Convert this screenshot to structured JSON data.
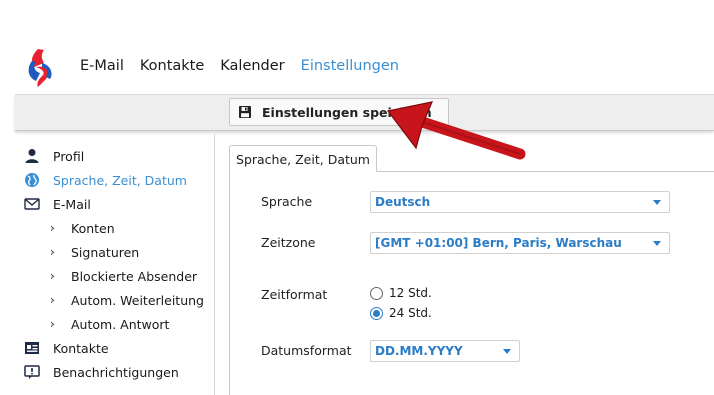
{
  "nav": {
    "items": [
      {
        "label": "E-Mail"
      },
      {
        "label": "Kontakte"
      },
      {
        "label": "Kalender"
      },
      {
        "label": "Einstellungen"
      }
    ],
    "active_index": 3
  },
  "toolbar": {
    "save_label": "Einstellungen speichern",
    "save_icon": "floppy-disk-icon"
  },
  "sidebar": {
    "items": [
      {
        "label": "Profil",
        "icon": "user-icon"
      },
      {
        "label": "Sprache, Zeit, Datum",
        "icon": "globe-icon"
      },
      {
        "label": "E-Mail",
        "icon": "envelope-icon"
      },
      {
        "label": "Konten"
      },
      {
        "label": "Signaturen"
      },
      {
        "label": "Blockierte Absender"
      },
      {
        "label": "Autom. Weiterleitung"
      },
      {
        "label": "Autom. Antwort"
      },
      {
        "label": "Kontakte",
        "icon": "contacts-icon"
      },
      {
        "label": "Benachrichtigungen",
        "icon": "notification-icon"
      }
    ]
  },
  "main": {
    "tab_label": "Sprache, Zeit, Datum",
    "sprache": {
      "label": "Sprache",
      "value": "Deutsch"
    },
    "zeitzone": {
      "label": "Zeitzone",
      "value": "[GMT +01:00] Bern, Paris, Warschau"
    },
    "zeitformat": {
      "label": "Zeitformat",
      "options": [
        "12 Std.",
        "24 Std."
      ],
      "selected": "24 Std."
    },
    "datumsformat": {
      "label": "Datumsformat",
      "value": "DD.MM.YYYY"
    }
  },
  "colors": {
    "accent": "#3a8fd4",
    "link": "#2a7cc7",
    "arrow": "#c8151b",
    "logo_red": "#e8212e",
    "logo_blue": "#1e5bbf"
  }
}
